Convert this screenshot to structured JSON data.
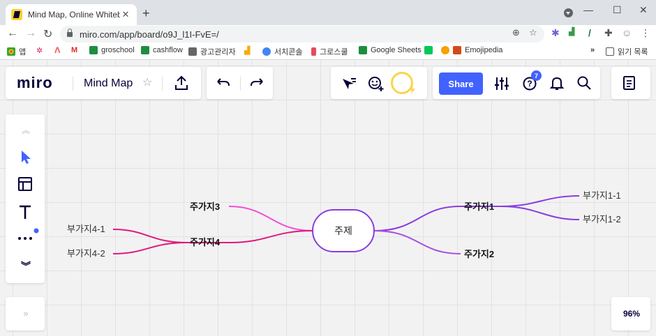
{
  "browser": {
    "tab_title": "Mind Map, Online Whiteboard f",
    "url": "miro.com/app/board/o9J_l1I-FvE=/",
    "bookmarks": [
      "앱",
      "groschool",
      "cashflow",
      "광고관리자",
      "서치콘솔",
      "그로스쿨",
      "Google Sheets",
      "Emojipedia"
    ],
    "reading_list": "읽기 목록"
  },
  "miro": {
    "logo": "miro",
    "board_name": "Mind Map",
    "share_label": "Share",
    "notification_count": "7",
    "zoom": "96%"
  },
  "mindmap": {
    "center": "주제",
    "branches": [
      "주가지1",
      "주가지2",
      "주가지3",
      "주가지4"
    ],
    "leaves": [
      "부가지1-1",
      "부가지1-2",
      "부가지4-1",
      "부가지4-2"
    ]
  },
  "colors": {
    "accent": "#4262ff",
    "branch_purple": "#8a3ce0",
    "branch_violet": "#a84ee0",
    "branch_pink": "#ee4fd7",
    "branch_magenta": "#e0197d"
  },
  "icons": {
    "back": "arrow-left-icon",
    "forward": "arrow-right-icon",
    "reload": "reload-icon",
    "star": "star-icon",
    "upload": "upload-icon",
    "undo": "undo-icon",
    "redo": "redo-icon",
    "settings": "sliders-icon",
    "help": "help-icon",
    "bell": "bell-icon",
    "search": "search-icon",
    "notes": "notes-icon"
  }
}
